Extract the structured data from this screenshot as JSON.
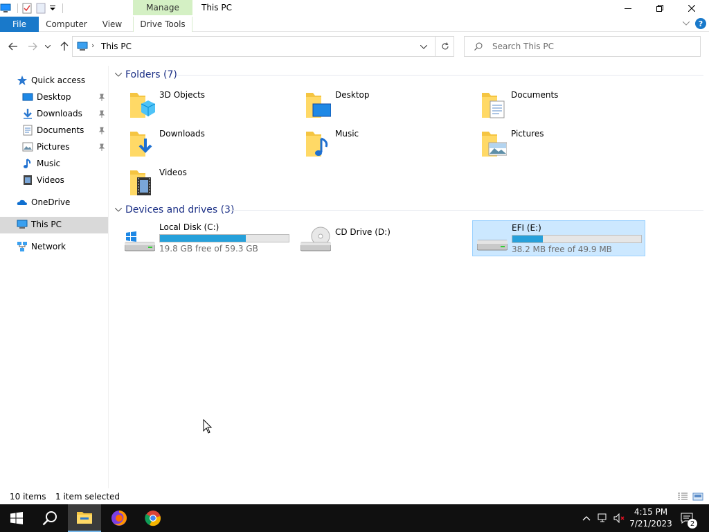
{
  "window": {
    "title": "This PC",
    "contextual_tab": "Manage",
    "controls": {
      "minimize": "minimize-icon",
      "restore": "restore-icon",
      "close": "close-icon"
    }
  },
  "ribbon": {
    "file_label": "File",
    "tabs": [
      {
        "label": "Computer"
      },
      {
        "label": "View"
      },
      {
        "label": "Drive Tools"
      }
    ],
    "help_label": "?"
  },
  "address": {
    "path": "This PC",
    "search_placeholder": "Search This PC"
  },
  "nav": {
    "quick_access": "Quick access",
    "quick_items": [
      {
        "label": "Desktop",
        "icon": "desktop-icon",
        "pinned": true
      },
      {
        "label": "Downloads",
        "icon": "downloads-icon",
        "pinned": true
      },
      {
        "label": "Documents",
        "icon": "documents-icon",
        "pinned": true
      },
      {
        "label": "Pictures",
        "icon": "pictures-icon",
        "pinned": true
      },
      {
        "label": "Music",
        "icon": "music-icon",
        "pinned": false
      },
      {
        "label": "Videos",
        "icon": "videos-icon",
        "pinned": false
      }
    ],
    "onedrive": "OneDrive",
    "this_pc": "This PC",
    "network": "Network"
  },
  "content": {
    "folders_header": "Folders (7)",
    "folders": [
      {
        "label": "3D Objects",
        "icon": "3d-objects-icon"
      },
      {
        "label": "Desktop",
        "icon": "desktop-folder-icon"
      },
      {
        "label": "Documents",
        "icon": "documents-folder-icon"
      },
      {
        "label": "Downloads",
        "icon": "downloads-folder-icon"
      },
      {
        "label": "Music",
        "icon": "music-folder-icon"
      },
      {
        "label": "Pictures",
        "icon": "pictures-folder-icon"
      },
      {
        "label": "Videos",
        "icon": "videos-folder-icon"
      }
    ],
    "devices_header": "Devices and drives (3)",
    "drives": [
      {
        "label": "Local Disk (C:)",
        "free": "19.8 GB free of 59.3 GB",
        "used_fraction": 0.666,
        "icon": "windows-drive-icon",
        "selected": false
      },
      {
        "label": "CD Drive (D:)",
        "icon": "cd-drive-icon",
        "selected": false
      },
      {
        "label": "EFI (E:)",
        "free": "38.2 MB free of 49.9 MB",
        "used_fraction": 0.234,
        "icon": "hard-drive-icon",
        "selected": true
      }
    ]
  },
  "status": {
    "item_count": "10 items",
    "selection": "1 item selected"
  },
  "taskbar": {
    "time": "4:15 PM",
    "date": "7/21/2023",
    "notification_count": "2",
    "accent": "#76b9ed"
  },
  "colors": {
    "accent": "#1979ca",
    "group_header": "#1e3287",
    "bar_fill": "#26a0da",
    "selection_bg": "#cce8ff",
    "manage_tab_bg": "#d4f0c4"
  }
}
